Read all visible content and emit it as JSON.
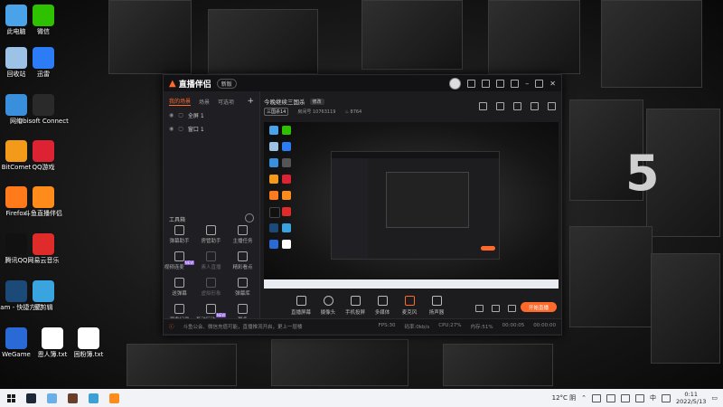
{
  "desktop": {
    "icons": [
      {
        "label": "此电脑",
        "icon": "computer-icon",
        "color": "#4aa3e8"
      },
      {
        "label": "微信",
        "icon": "wechat-icon",
        "color": "#2dc100"
      },
      {
        "label": "回收站",
        "icon": "recycle-bin-icon",
        "color": "#9cc3e6"
      },
      {
        "label": "迅雷",
        "icon": "thunder-icon",
        "color": "#2c7cf6"
      },
      {
        "label": "网络",
        "icon": "network-icon",
        "color": "#3a8fdc"
      },
      {
        "label": "Ubisoft Connect",
        "icon": "ubisoft-icon",
        "color": "#2a2a2a"
      },
      {
        "label": "BitComet",
        "icon": "bitcomet-icon",
        "color": "#f39a1a"
      },
      {
        "label": "QQ游戏",
        "icon": "qqgame-icon",
        "color": "#d23"
      },
      {
        "label": "Firefox",
        "icon": "firefox-icon",
        "color": "#ff7a1a"
      },
      {
        "label": "斗鱼直播伴侣",
        "icon": "douyu-icon",
        "color": "#ff8c1a"
      },
      {
        "label": "腾讯QQ",
        "icon": "qq-icon",
        "color": "#111"
      },
      {
        "label": "网易云音乐",
        "icon": "netease-music-icon",
        "color": "#e02b2b"
      },
      {
        "label": "steam - 快捷方式",
        "icon": "steam-icon",
        "color": "#1b4a78"
      },
      {
        "label": "爱剪辑",
        "icon": "aijianji-icon",
        "color": "#3aa4e0"
      },
      {
        "label": "WeGame",
        "icon": "wegame-icon",
        "color": "#2a6ad6"
      },
      {
        "label": "恩人簿.txt",
        "icon": "text-file-icon",
        "color": "#ffffff"
      },
      {
        "label": "困粉簿.txt",
        "icon": "text-file-icon",
        "color": "#ffffff"
      }
    ]
  },
  "app": {
    "title": "直播伴侣",
    "version_label": "新版",
    "tabs": [
      "我的场景",
      "场景",
      "可选项"
    ],
    "active_tab": "我的场景",
    "sources": [
      "全屏 1",
      "窗口 1"
    ],
    "tools_header": "工具箱",
    "tools": [
      {
        "label": "弹幕助手",
        "dim": false,
        "badge": ""
      },
      {
        "label": "房管助手",
        "dim": false,
        "badge": ""
      },
      {
        "label": "主播任务",
        "dim": false,
        "badge": ""
      },
      {
        "label": "视频连麦",
        "dim": false,
        "badge": "NEW"
      },
      {
        "label": "素人直播",
        "dim": true,
        "badge": ""
      },
      {
        "label": "精彩看点",
        "dim": false,
        "badge": ""
      },
      {
        "label": "送弹幕",
        "dim": false,
        "badge": ""
      },
      {
        "label": "虚拟形象",
        "dim": true,
        "badge": ""
      },
      {
        "label": "弹幕库",
        "dim": false,
        "badge": ""
      },
      {
        "label": "观看记录",
        "dim": false,
        "badge": ""
      },
      {
        "label": "互动玩法",
        "dim": false,
        "badge": "NEW"
      },
      {
        "label": "更多",
        "dim": false,
        "badge": ""
      }
    ],
    "room": {
      "title": "今晚继续三国杀",
      "tag": "修改",
      "category": "三国杀14",
      "room_id_label": "房间号",
      "room_id": "10763119",
      "heat_value": "8764"
    },
    "controls": [
      {
        "label": "直播屏幕",
        "icon": "screen-icon"
      },
      {
        "label": "摄像头",
        "icon": "camera-icon"
      },
      {
        "label": "手机投屏",
        "icon": "phone-cast-icon"
      },
      {
        "label": "多媒体",
        "icon": "media-icon"
      },
      {
        "label": "麦克风",
        "icon": "microphone-icon"
      },
      {
        "label": "扬声器",
        "icon": "speaker-icon"
      }
    ],
    "live_button": "开始直播",
    "status": {
      "warning": "斗鱼公会、微信充值可能，直播推流开启，更上一层楼",
      "fps": "FPS:30",
      "bitrate": "码率:0kb/s",
      "cpu": "CPU:27%",
      "mem": "内存:51%",
      "duration": "00:00:05",
      "time": "00:00:00"
    }
  },
  "taskbar": {
    "weather": "12°C 阴",
    "lang": "中",
    "time": "0:11",
    "date": "2022/5/13",
    "colors": {
      "accent": "#ff6a2b"
    }
  }
}
